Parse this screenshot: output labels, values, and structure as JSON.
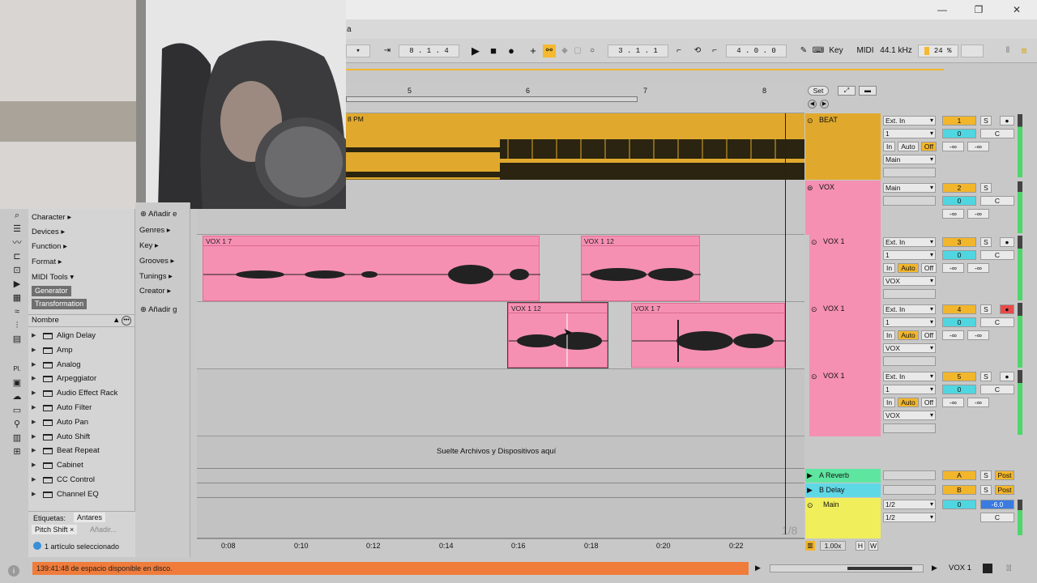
{
  "window": {
    "minimize": "—",
    "maximize": "❐",
    "close": "✕"
  },
  "transport": {
    "arrangement_position": "8 . 1 . 4",
    "loop_start": "3 . 1 . 1",
    "loop_length": "4 . 0 . 0",
    "key_label": "Key",
    "midi_label": "MIDI",
    "sample_rate": "44.1 kHz",
    "cpu": "24 %",
    "title_fragment": "a"
  },
  "ruler": {
    "bars": [
      "5",
      "6",
      "7",
      "8"
    ],
    "set_label": "Set",
    "time_marks": [
      "0:08",
      "0:10",
      "0:12",
      "0:14",
      "0:16",
      "0:18",
      "0:20",
      "0:22"
    ],
    "beat_clip_label": "8 PM"
  },
  "browser": {
    "categories": [
      "Character",
      "Devices",
      "Function",
      "Format",
      "MIDI Tools"
    ],
    "tags": [
      "Generator",
      "Transformation"
    ],
    "column_header": "Nombre",
    "items": [
      "Align Delay",
      "Amp",
      "Analog",
      "Arpeggiator",
      "Audio Effect Rack",
      "Auto Filter",
      "Auto Pan",
      "Auto Shift",
      "Beat Repeat",
      "Cabinet",
      "CC Control",
      "Channel EQ"
    ],
    "labels_title": "Etiquetas:",
    "label_antares": "Antares",
    "label_pitch": "Pitch Shift",
    "label_add": "Añadir...",
    "selected_info": "1 artículo seleccionado",
    "groups": [
      "Añadir e",
      "Genres",
      "Key",
      "Grooves",
      "Tunings",
      "Creator",
      "Añadir g"
    ]
  },
  "tracks": [
    {
      "name": "BEAT",
      "input": "Ext. In",
      "chan": "1",
      "monitor": [
        "In",
        "Auto",
        "Off"
      ],
      "output": "Main",
      "number": "1",
      "vol": "0",
      "pan": "C",
      "sends": [
        "-∞",
        "-∞"
      ],
      "color": "#e0a92e"
    },
    {
      "name": "VOX",
      "input": "Main",
      "chan": "",
      "monitor": [],
      "output": "",
      "number": "2",
      "vol": "0",
      "pan": "C",
      "sends": [
        "-∞",
        "-∞"
      ],
      "color": "#f590b3"
    },
    {
      "name": "VOX 1",
      "input": "Ext. In",
      "chan": "1",
      "monitor": [
        "In",
        "Auto",
        "Off"
      ],
      "output": "VOX",
      "number": "3",
      "vol": "0",
      "pan": "C",
      "sends": [
        "-∞",
        "-∞"
      ],
      "color": "#f590b3"
    },
    {
      "name": "VOX 1",
      "input": "Ext. In",
      "chan": "1",
      "monitor": [
        "In",
        "Auto",
        "Off"
      ],
      "output": "VOX",
      "number": "4",
      "vol": "0",
      "pan": "C",
      "sends": [
        "-∞",
        "-∞"
      ],
      "color": "#f590b3"
    },
    {
      "name": "VOX 1",
      "input": "Ext. In",
      "chan": "1",
      "monitor": [
        "In",
        "Auto",
        "Off"
      ],
      "output": "VOX",
      "number": "5",
      "vol": "0",
      "pan": "C",
      "sends": [
        "-∞",
        "-∞"
      ],
      "color": "#f590b3"
    }
  ],
  "clips": {
    "c1": "VOX 1 7",
    "c2": "VOX 1 12",
    "c3": "VOX 1 12",
    "c4": "VOX 1 7"
  },
  "drop_text": "Suelte Archivos y Dispositivos aquí",
  "returns": [
    {
      "name": "A Reverb",
      "letter": "A",
      "solo": "S",
      "post": "Post",
      "color": "#5ee6a0"
    },
    {
      "name": "B Delay",
      "letter": "B",
      "solo": "S",
      "post": "Post",
      "color": "#5fd8e6"
    }
  ],
  "main": {
    "name": "Main",
    "out1": "1/2",
    "out2": "1/2",
    "vol": "0",
    "db": "-6.0",
    "pan": "C",
    "color": "#f0ee5a"
  },
  "bottom": {
    "zoom": "1.00x",
    "h": "H",
    "w": "W",
    "fraction": "1/8",
    "status": "139:41:48 de espacio disponible en disco.",
    "track_name": "VOX 1"
  }
}
